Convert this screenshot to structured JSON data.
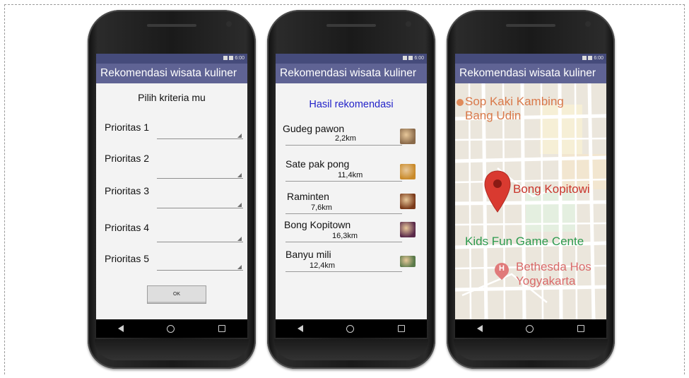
{
  "status_time": "6:00",
  "app_title": "Rekomendasi wisata kuliner",
  "screen1": {
    "heading": "Pilih kriteria mu",
    "priorities": [
      "Prioritas 1",
      "Prioritas 2",
      "Prioritas 3",
      "Prioritas 4",
      "Prioritas 5"
    ],
    "ok_label": "OK"
  },
  "screen2": {
    "heading": "Hasil rekomendasi",
    "results": [
      {
        "name": "Gudeg pawon",
        "distance": "2,2km",
        "thumb_color": "#8a6a4a"
      },
      {
        "name": "Sate pak pong",
        "distance": "11,4km",
        "thumb_color": "#c98a2a"
      },
      {
        "name": "Raminten",
        "distance": "7,6km",
        "thumb_color": "#7a3a1a"
      },
      {
        "name": "Bong Kopitown",
        "distance": "16,3km",
        "thumb_color": "#5a2a4a"
      },
      {
        "name": "Banyu mili",
        "distance": "12,4km",
        "thumb_color": "#5a7a4a"
      }
    ]
  },
  "screen3": {
    "places": [
      {
        "name": "Sop Kaki Kambing Bang Udin",
        "line1": "Sop Kaki Kambing",
        "line2": "Bang Udin",
        "color": "#d9794a"
      },
      {
        "name": "Bong Kopitowi",
        "line1": "Bong Kopitowi",
        "color": "#c9352c"
      },
      {
        "name": "Kids Fun Game Center",
        "line1": "Kids Fun Game Cente",
        "color": "#2d9a4e"
      },
      {
        "name": "Bethesda Hospital Yogyakarta",
        "line1": "Bethesda Hos",
        "line2": "Yogyakarta",
        "color": "#d96a6a"
      }
    ],
    "hospital_glyph": "H"
  },
  "colors": {
    "app_bar": "#5f6394",
    "status_bar": "#454b7b",
    "heading_blue": "#2323c9",
    "marker_red": "#d93a30"
  }
}
